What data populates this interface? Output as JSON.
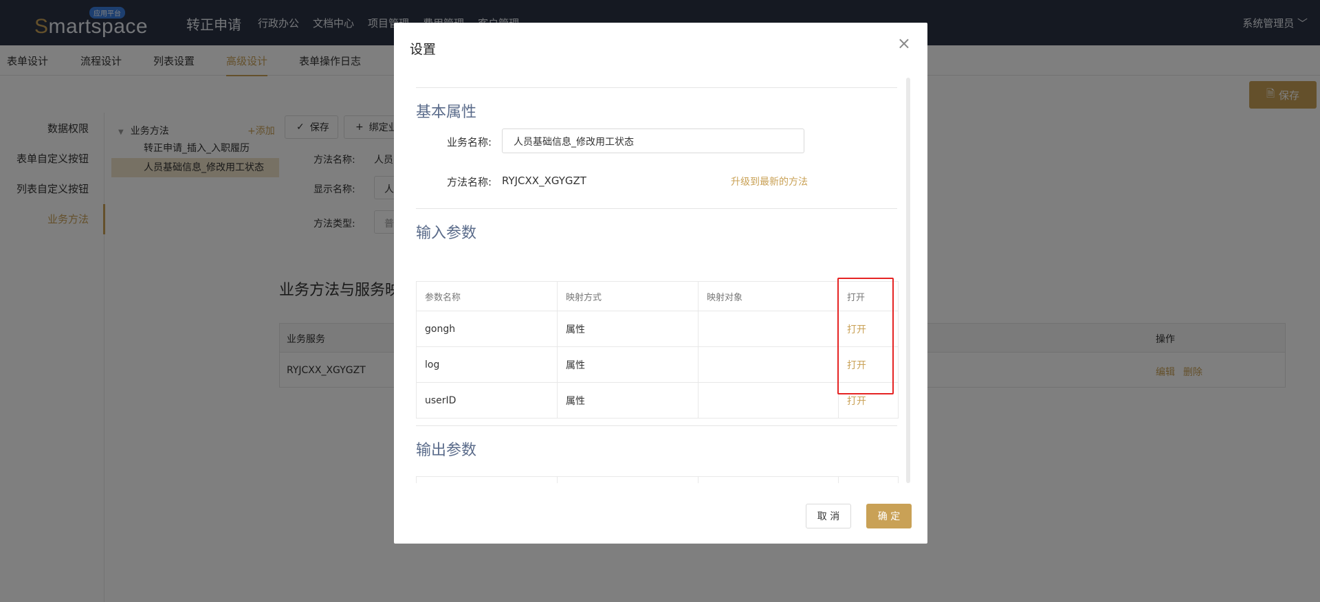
{
  "header": {
    "logo_text": "Smartspace",
    "logo_badge": "应用平台",
    "app_title": "转正申请",
    "menu": [
      "行政办公",
      "文档中心",
      "项目管理",
      "费用管理",
      "客户管理"
    ],
    "user": "系统管理员"
  },
  "tabs": [
    "表单设计",
    "流程设计",
    "列表设置",
    "高级设计",
    "表单操作日志"
  ],
  "active_tab": "高级设计",
  "save_main": "保存",
  "leftnav": [
    "数据权限",
    "表单自定义按钮",
    "列表自定义按钮",
    "业务方法"
  ],
  "tree": {
    "root": "业务方法",
    "add": "+添加",
    "children": [
      "转正申请_插入_入职履历",
      "人员基础信息_修改用工状态"
    ]
  },
  "toolbar": {
    "save": "保存",
    "bind": "绑定业"
  },
  "form": {
    "method_name_label": "方法名称:",
    "method_name_value": "人员",
    "display_name_label": "显示名称:",
    "display_name_value": "人",
    "method_type_label": "方法类型:",
    "method_type_value": "普"
  },
  "bg_section_title": "业务方法与服务映",
  "bg_table": {
    "col1": "业务服务",
    "col_op": "操作",
    "row_value": "RYJCXX_XGYGZT",
    "edit": "编辑",
    "delete": "删除"
  },
  "modal": {
    "title": "设置",
    "close": "×",
    "basic_title": "基本属性",
    "biz_name_label": "业务名称:",
    "biz_name_value": "人员基础信息_修改用工状态",
    "method_name_label": "方法名称:",
    "method_name_value": "RYJCXX_XGYGZT",
    "upgrade": "升级到最新的方法",
    "input_title": "输入参数",
    "output_title": "输出参数",
    "params_head": [
      "参数名称",
      "映射方式",
      "映射对象",
      "打开"
    ],
    "params": [
      {
        "name": "gongh",
        "mode": "属性",
        "target": "",
        "action": "打开"
      },
      {
        "name": "log",
        "mode": "属性",
        "target": "",
        "action": "打开"
      },
      {
        "name": "userID",
        "mode": "属性",
        "target": "",
        "action": "打开"
      }
    ],
    "cancel": "取 消",
    "ok": "确 定"
  },
  "colors": {
    "accent": "#c9a156",
    "topbar": "#2b3245",
    "highlight": "#e52222"
  }
}
